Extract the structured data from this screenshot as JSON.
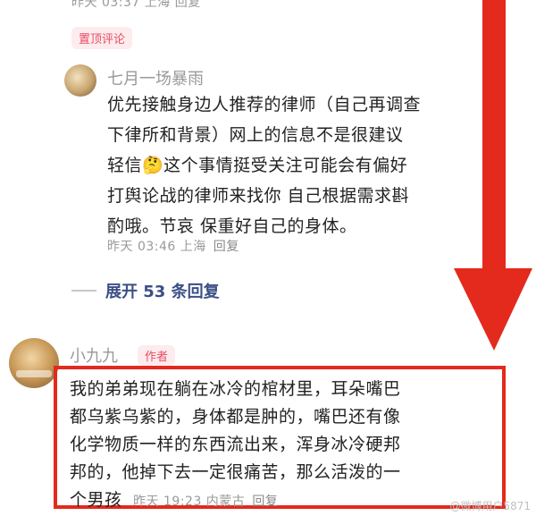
{
  "top_meta": "昨天 03:37 上海  回复",
  "pinned_label": "置顶评论",
  "comment1": {
    "username": "七月一场暴雨",
    "lines": [
      "优先接触身边人推荐的律师（自己再调查",
      "下律所和背景）网上的信息不是很建议",
      "轻信🤔这个事情挺受关注可能会有偏好",
      "打舆论战的律师来找你 自己根据需求斟",
      "酌哦。节哀 保重好自己的身体。"
    ],
    "time": "昨天 03:46 上海",
    "reply_label": "回复"
  },
  "expand_label": "展开 53 条回复",
  "comment2": {
    "username": "小九九",
    "author_tag": "作者",
    "lines": [
      "我的弟弟现在躺在冰冷的棺材里，耳朵嘴巴",
      "都乌紫乌紫的，身体都是肿的，嘴巴还有像",
      "化学物质一样的东西流出来，浑身冰冷硬邦",
      "邦的，他掉下去一定很痛苦，那么活泼的一"
    ],
    "last_line": "个男孩",
    "time": "昨天 19:23 内蒙古",
    "reply_label": "回复"
  },
  "watermark": "@微博用户5871",
  "colors": {
    "arrow": "#e4291d",
    "highlight_border": "#e4291d",
    "tag_bg": "#fdecee",
    "tag_text": "#ea4c63",
    "link": "#3b4f86"
  }
}
